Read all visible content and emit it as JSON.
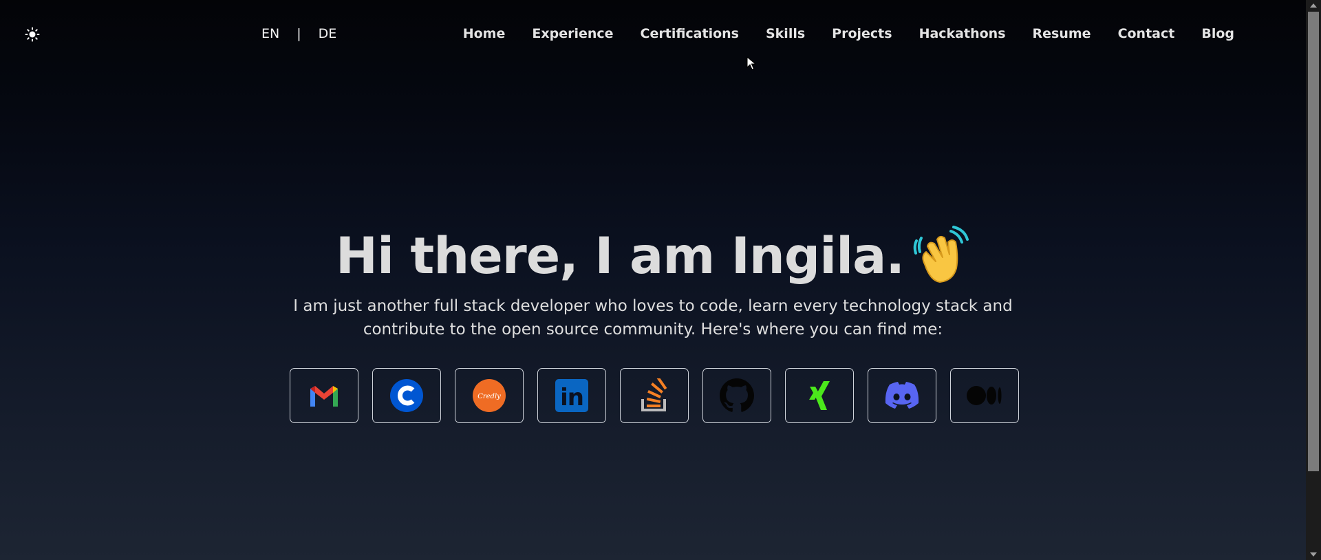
{
  "theme_toggle": {
    "icon": "sun-icon"
  },
  "language": {
    "options": [
      "EN",
      "DE"
    ],
    "separator": "|"
  },
  "nav": {
    "items": [
      "Home",
      "Experience",
      "Certifications",
      "Skills",
      "Projects",
      "Hackathons",
      "Resume",
      "Contact",
      "Blog"
    ]
  },
  "hero": {
    "title": "Hi there, I am Ingila.",
    "emoji": "waving-hand-icon",
    "subtitle_line1": "I am just another full stack developer who loves to code, learn every technology stack and",
    "subtitle_line2": "contribute to the open source community. Here's where you can find me:"
  },
  "socials": [
    {
      "icon": "gmail-icon"
    },
    {
      "icon": "coursera-icon"
    },
    {
      "icon": "credly-icon",
      "text": "Credly"
    },
    {
      "icon": "linkedin-icon",
      "text": "in"
    },
    {
      "icon": "stackoverflow-icon"
    },
    {
      "icon": "github-icon"
    },
    {
      "icon": "xing-icon"
    },
    {
      "icon": "discord-icon"
    },
    {
      "icon": "medium-icon"
    }
  ],
  "colors": {
    "background_top": "#030407",
    "background_bottom": "#1d2533",
    "title": "#dcdcdc",
    "card_border": "#cfd3da",
    "xing_green": "#4be81b",
    "discord_blurple": "#5865f2",
    "credly_orange": "#ef6c24",
    "linkedin_blue": "#0a66c2",
    "coursera_blue": "#0056d2",
    "stackoverflow_orange": "#f48024"
  }
}
